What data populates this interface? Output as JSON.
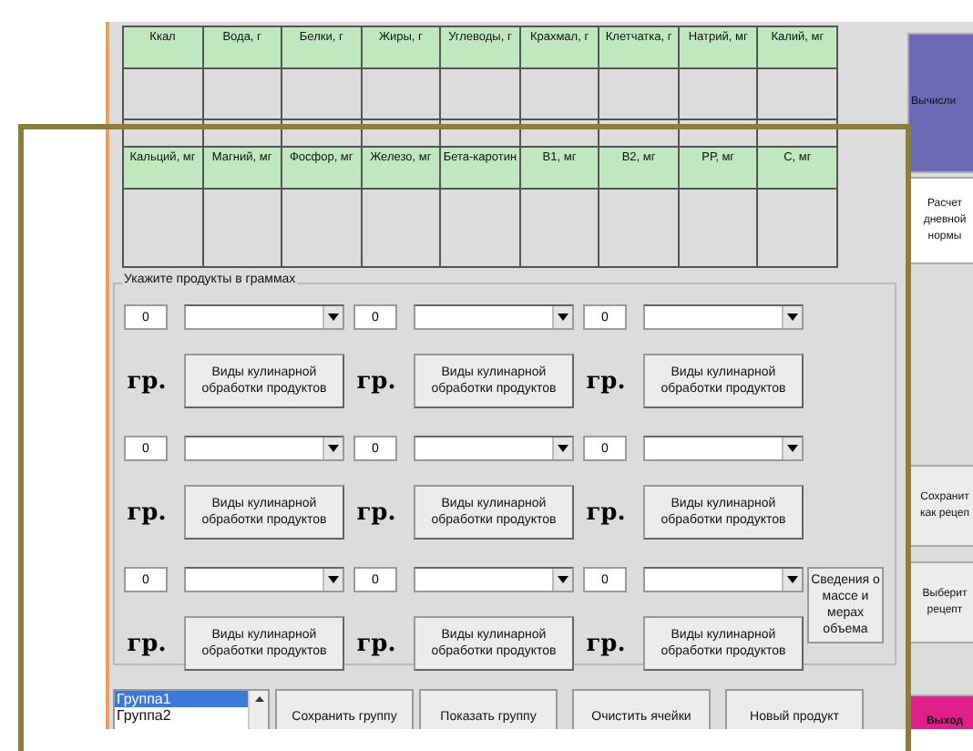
{
  "nutrient_table": {
    "header_rows": [
      [
        "Ккал",
        "Вода, г",
        "Белки, г",
        "Жиры, г",
        "Углеводы, г",
        "Крахмал, г",
        "Клетчатка, г",
        "Натрий, мг",
        "Калий, мг"
      ],
      [
        "Кальций, мг",
        "Магний, мг",
        "Фосфор, мг",
        "Железо, мг",
        "Бета-каротин",
        "В1, мг",
        "В2, мг",
        "РР, мг",
        "С, мг"
      ]
    ]
  },
  "products": {
    "title": "Укажите продукты в граммах",
    "items": [
      {
        "amount": "0",
        "unit": "гр.",
        "button": "Виды кулинарной обработки продуктов"
      },
      {
        "amount": "0",
        "unit": "гр.",
        "button": "Виды кулинарной обработки продуктов"
      },
      {
        "amount": "0",
        "unit": "гр.",
        "button": "Виды кулинарной обработки продуктов"
      },
      {
        "amount": "0",
        "unit": "гр.",
        "button": "Виды кулинарной обработки продуктов"
      },
      {
        "amount": "0",
        "unit": "гр.",
        "button": "Виды кулинарной обработки продуктов"
      },
      {
        "amount": "0",
        "unit": "гр.",
        "button": "Виды кулинарной обработки продуктов"
      },
      {
        "amount": "0",
        "unit": "гр.",
        "button": "Виды кулинарной обработки продуктов"
      },
      {
        "amount": "0",
        "unit": "гр.",
        "button": "Виды кулинарной обработки продуктов"
      },
      {
        "amount": "0",
        "unit": "гр.",
        "button": "Виды кулинарной обработки продуктов"
      }
    ],
    "info_button": "Сведения о массе и мерах объема"
  },
  "group_list": [
    {
      "label": "Группа1",
      "selected": true
    },
    {
      "label": "Группа2",
      "selected": false
    }
  ],
  "buttons": [
    "Сохранить группу",
    "Показать группу",
    "Очистить ячейки",
    "Новый продукт"
  ],
  "side_buttons": [
    {
      "label": "Вычисли",
      "kind": "primary"
    },
    {
      "label": "Расчет дневной нормы",
      "kind": "light"
    },
    {
      "label": "Сохранит как рецеп",
      "kind": "plain"
    },
    {
      "label": "Выберит рецепт",
      "kind": "plain"
    },
    {
      "label": "Выход",
      "kind": "exit"
    }
  ]
}
